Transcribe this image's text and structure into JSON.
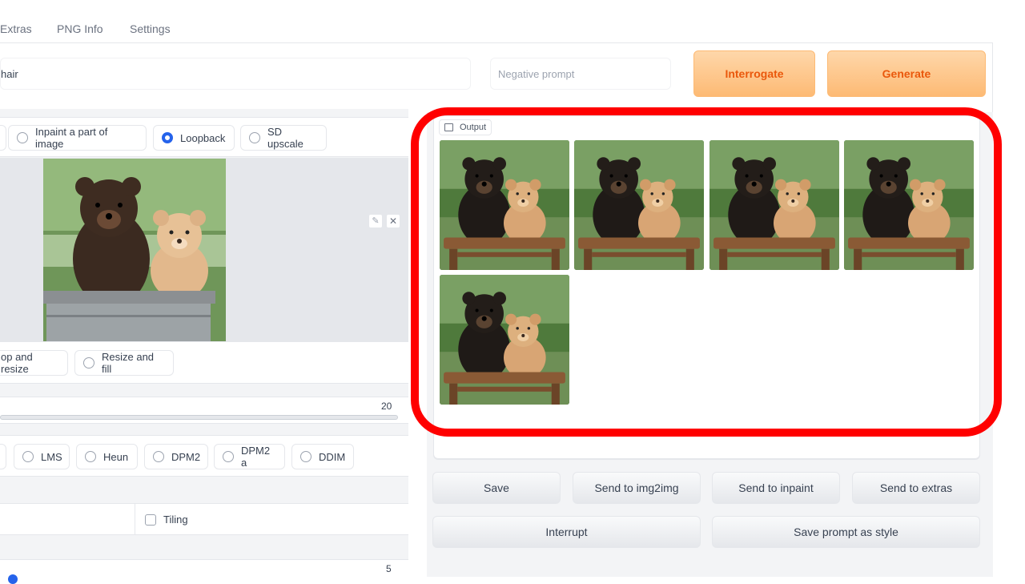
{
  "tabs": [
    "Extras",
    "PNG Info",
    "Settings"
  ],
  "prompt": {
    "value": "hair",
    "negative_placeholder": "Negative prompt"
  },
  "buttons": {
    "interrogate": "Interrogate",
    "generate": "Generate"
  },
  "mode_options": [
    {
      "label": "Inpaint a part of image",
      "selected": false
    },
    {
      "label": "Loopback",
      "selected": true
    },
    {
      "label": "SD upscale",
      "selected": false
    }
  ],
  "resize_options": [
    "op and resize",
    "Resize and fill"
  ],
  "steps": {
    "value": "20"
  },
  "sampler_options": [
    "LMS",
    "Heun",
    "DPM2",
    "DPM2 a",
    "DDIM"
  ],
  "tiling": {
    "label": "Tiling",
    "checked": false
  },
  "batch": {
    "value": "5"
  },
  "output": {
    "label": "Output",
    "images": [
      "bear-pair-1",
      "bear-pair-2",
      "bear-pair-3",
      "bear-pair-4",
      "bear-pair-5"
    ]
  },
  "actions": {
    "save": "Save",
    "send_img2img": "Send to img2img",
    "send_inpaint": "Send to inpaint",
    "send_extras": "Send to extras",
    "interrupt": "Interrupt",
    "save_style": "Save prompt as style"
  },
  "colors": {
    "accent": "#ea580c",
    "radio_selected": "#2563eb",
    "highlight": "#ff0000"
  }
}
